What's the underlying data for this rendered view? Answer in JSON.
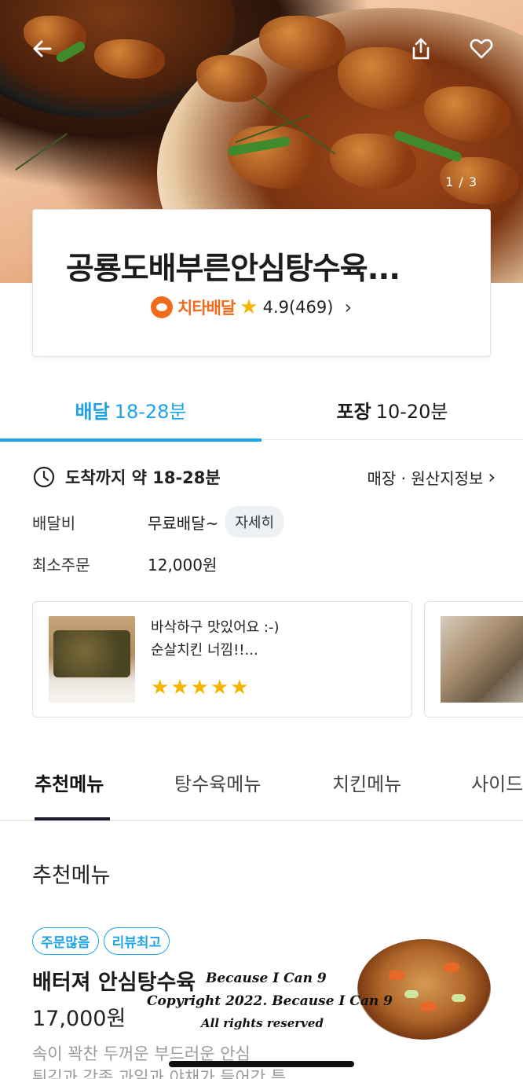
{
  "hero": {
    "image_counter": "1 / 3"
  },
  "store": {
    "name": "공룡도배부른안심탕수육...",
    "brand": "치타배달",
    "rating": "4.9(469)"
  },
  "order_tabs": [
    {
      "type": "배달",
      "time": "18-28분",
      "active": true
    },
    {
      "type": "포장",
      "time": "10-20분",
      "active": false
    }
  ],
  "delivery": {
    "eta": "도착까지 약 18-28분",
    "store_info_link": "매장 · 원산지정보",
    "fee_label": "배달비",
    "fee_value": "무료배달~",
    "fee_detail_button": "자세히",
    "min_order_label": "최소주문",
    "min_order_value": "12,000원"
  },
  "reviews": [
    {
      "line1": "바삭하구 맛있어요 :-)",
      "line2": "순살치킨 너낌!!...",
      "stars": 5
    }
  ],
  "menu_tabs": [
    {
      "label": "추천메뉴",
      "active": true
    },
    {
      "label": "탕수육메뉴",
      "active": false
    },
    {
      "label": "치킨메뉴",
      "active": false
    },
    {
      "label": "사이드",
      "active": false
    }
  ],
  "section_title": "추천메뉴",
  "menu_item": {
    "badges": [
      "주문많음",
      "리뷰최고"
    ],
    "name": "배터져 안심탕수육",
    "price": "17,000원",
    "desc_line1": "속이 꽉찬 두꺼운 부드러운 안심",
    "desc_line2": "튀김과 각종 과일과 야채가 들어간 특..."
  },
  "watermark": {
    "line1": "Because I Can 9",
    "line2": "Copyright 2022. Because I Can 9",
    "line3": "All rights reserved"
  },
  "colors": {
    "accent": "#1fa3e8",
    "brand_orange": "#f26a1b",
    "star": "#f6b400"
  }
}
